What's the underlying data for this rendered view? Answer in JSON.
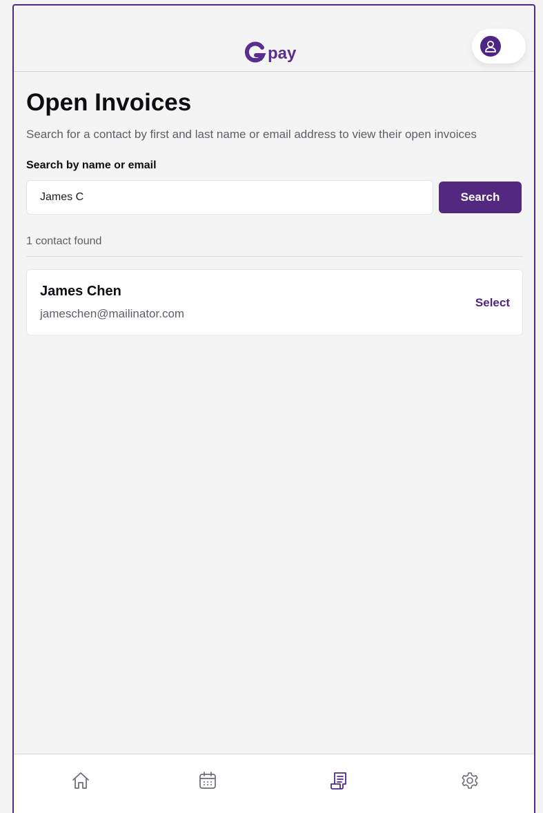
{
  "header": {
    "logo_text": "pay",
    "brand_color": "#53287f"
  },
  "page": {
    "title": "Open Invoices",
    "subtitle": "Search for a contact by first and last name or email address to view their open invoices"
  },
  "search": {
    "label": "Search by name or email",
    "value": "James C",
    "button_label": "Search"
  },
  "results": {
    "count_text": "1 contact found",
    "contacts": [
      {
        "name": "James Chen",
        "email": "jameschen@mailinator.com",
        "action_label": "Select"
      }
    ]
  },
  "bottom_nav": {
    "items": [
      {
        "icon": "home-icon",
        "active": false
      },
      {
        "icon": "calendar-icon",
        "active": false
      },
      {
        "icon": "invoice-icon",
        "active": true
      },
      {
        "icon": "settings-icon",
        "active": false
      }
    ]
  }
}
